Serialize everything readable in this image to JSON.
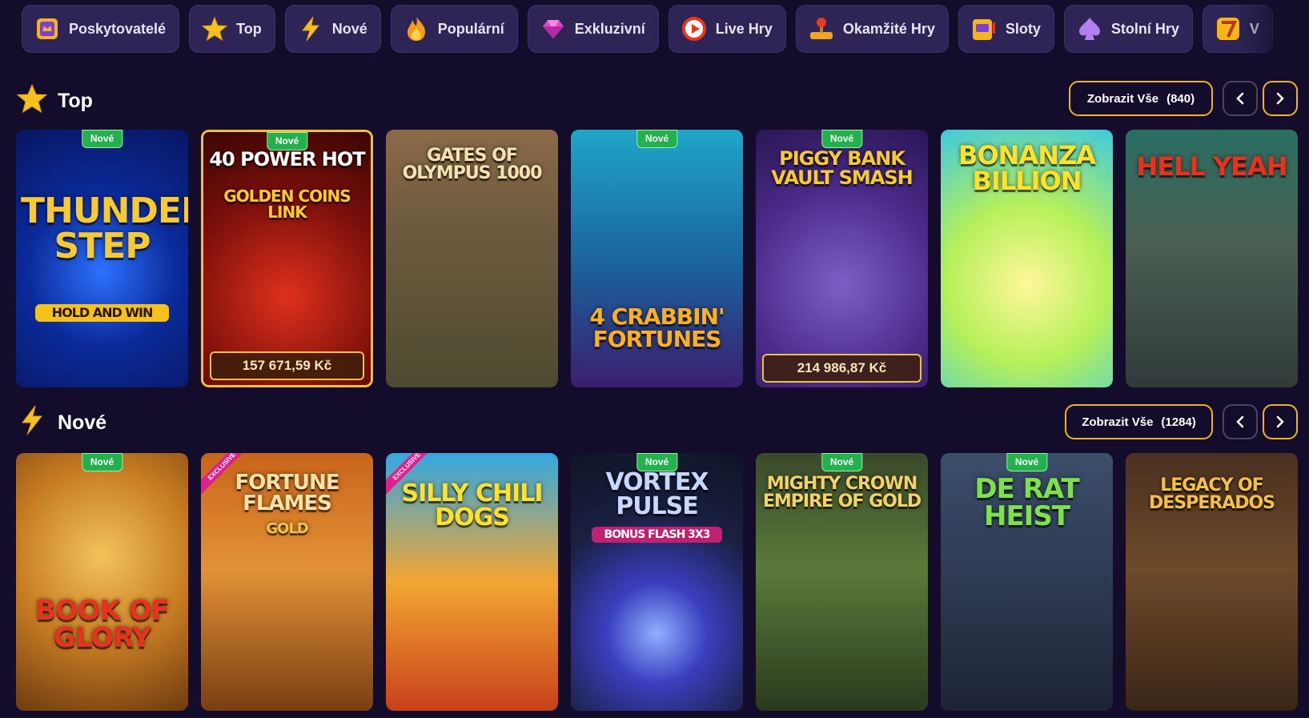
{
  "nav": {
    "categories": [
      {
        "label": "Poskytovatelé",
        "icon": "providers-icon"
      },
      {
        "label": "Top",
        "icon": "star-icon"
      },
      {
        "label": "Nové",
        "icon": "lightning-icon"
      },
      {
        "label": "Populární",
        "icon": "flame-icon"
      },
      {
        "label": "Exkluzivní",
        "icon": "gem-icon"
      },
      {
        "label": "Live Hry",
        "icon": "play-icon"
      },
      {
        "label": "Okamžité Hry",
        "icon": "joystick-icon"
      },
      {
        "label": "Sloty",
        "icon": "slot-machine-icon"
      },
      {
        "label": "Stolní Hry",
        "icon": "spade-icon"
      },
      {
        "label": "V",
        "icon": "seven-icon"
      }
    ]
  },
  "sections": {
    "top": {
      "title": "Top",
      "icon": "star-icon",
      "view_all_label": "Zobrazit Vše",
      "view_all_count": "(840)",
      "games": [
        {
          "title": "Thunder Step",
          "subtitle": "Hold and Win",
          "badge": "Nové",
          "jackpot": ""
        },
        {
          "title": "40 Power Hot",
          "subtitle": "Golden Coins Link",
          "badge": "Nové",
          "jackpot": "157 671,59 Kč"
        },
        {
          "title": "Gates of Olympus 1000",
          "subtitle": "",
          "badge": "",
          "jackpot": ""
        },
        {
          "title": "4 Crabbin' Fortunes",
          "subtitle": "",
          "badge": "Nové",
          "jackpot": ""
        },
        {
          "title": "Piggy Bank Vault Smash",
          "subtitle": "",
          "badge": "Nové",
          "jackpot": "214 986,87 Kč"
        },
        {
          "title": "Bonanza Billion",
          "subtitle": "",
          "badge": "",
          "jackpot": ""
        },
        {
          "title": "Hell Yeah",
          "subtitle": "",
          "badge": "",
          "jackpot": ""
        }
      ]
    },
    "new": {
      "title": "Nové",
      "icon": "lightning-icon",
      "view_all_label": "Zobrazit Vše",
      "view_all_count": "(1284)",
      "games": [
        {
          "title": "Book of Glory",
          "subtitle": "",
          "badge": "Nové",
          "exclusive": ""
        },
        {
          "title": "Fortune Flames",
          "subtitle": "Gold",
          "badge": "",
          "exclusive": "EXCLUSIVE"
        },
        {
          "title": "Silly Chili Dogs",
          "subtitle": "",
          "badge": "",
          "exclusive": "EXCLUSIVE"
        },
        {
          "title": "Vortex Pulse",
          "subtitle": "Bonus Flash 3x3",
          "badge": "Nové",
          "exclusive": ""
        },
        {
          "title": "Mighty Crown Empire of Gold",
          "subtitle": "",
          "badge": "Nové",
          "exclusive": ""
        },
        {
          "title": "De Rat Heist",
          "subtitle": "",
          "badge": "Nové",
          "exclusive": ""
        },
        {
          "title": "Legacy of Desperados",
          "subtitle": "",
          "badge": "",
          "exclusive": ""
        }
      ]
    }
  },
  "colors": {
    "background": "#140c2b",
    "nav_button": "#2e2455",
    "accent_gold": "#f0b323",
    "badge_green": "#22b14c",
    "exclusive_pink": "#e0208c"
  }
}
